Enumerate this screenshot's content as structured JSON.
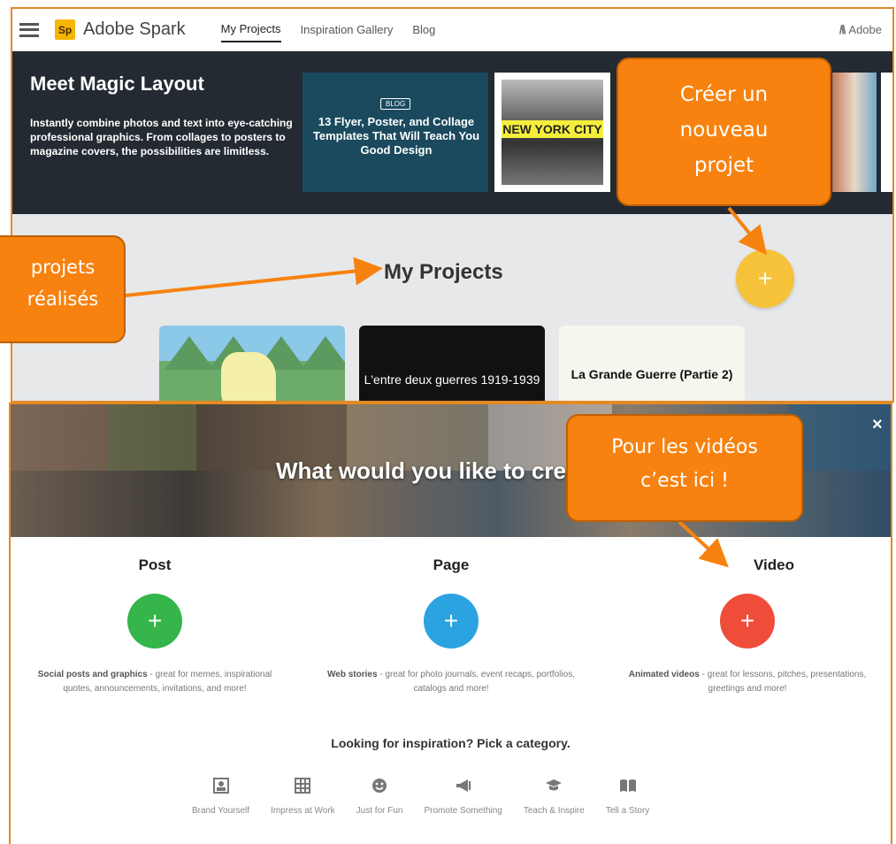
{
  "app": {
    "brand": "Adobe Spark",
    "logo_text": "Sp",
    "nav": [
      {
        "label": "My Projects",
        "active": true
      },
      {
        "label": "Inspiration Gallery",
        "active": false
      },
      {
        "label": "Blog",
        "active": false
      }
    ],
    "adobe_label": "Adobe"
  },
  "banner": {
    "title": "Meet Magic Layout",
    "text": "Instantly combine photos and text into eye-catching professional graphics. From collages to posters to magazine covers, the possibilities are limitless.",
    "cards": [
      {
        "tag": "BLOG",
        "title": "13 Flyer, Poster, and Collage Templates That Will Teach You Good Design"
      },
      {
        "title": "NEW YORK CITY"
      }
    ]
  },
  "projects": {
    "title": "My Projects",
    "new_button": "+",
    "cards": [
      {
        "title": ""
      },
      {
        "title": "L'entre deux guerres 1919-1939"
      },
      {
        "title": "La Grande Guerre (Partie 2)"
      }
    ]
  },
  "modal": {
    "title": "What would you like to cre",
    "close": "×",
    "options": [
      {
        "name": "Post",
        "plus": "+",
        "bold": "Social posts and graphics",
        "rest": " - great for memes, inspirational quotes, announcements, invitations, and more!",
        "color": "#35b54a"
      },
      {
        "name": "Page",
        "plus": "+",
        "bold": "Web stories",
        "rest": " - great for photo journals, event recaps, portfolios, catalogs and more!",
        "color": "#2aa3e0"
      },
      {
        "name": "Video",
        "plus": "+",
        "bold": "Animated videos",
        "rest": " - great for lessons, pitches, presentations, greetings and more!",
        "color": "#ef4c3a"
      }
    ],
    "inspiration_title": "Looking for inspiration? Pick a category.",
    "categories": [
      {
        "label": "Brand Yourself",
        "icon": "portrait-icon"
      },
      {
        "label": "Impress at Work",
        "icon": "grid-icon"
      },
      {
        "label": "Just for Fun",
        "icon": "smiley-icon"
      },
      {
        "label": "Promote Something",
        "icon": "megaphone-icon"
      },
      {
        "label": "Teach & Inspire",
        "icon": "graduation-cap-icon"
      },
      {
        "label": "Tell a Story",
        "icon": "book-icon"
      }
    ]
  },
  "callouts": {
    "creer": [
      "Créer un",
      "nouveau",
      "projet"
    ],
    "projets": [
      "projets",
      "réalisés"
    ],
    "video": [
      "Pour les vidéos",
      "c’est ici !"
    ]
  },
  "colors": {
    "callout": "#f7820f",
    "yellow_fab": "#f6c23a"
  }
}
